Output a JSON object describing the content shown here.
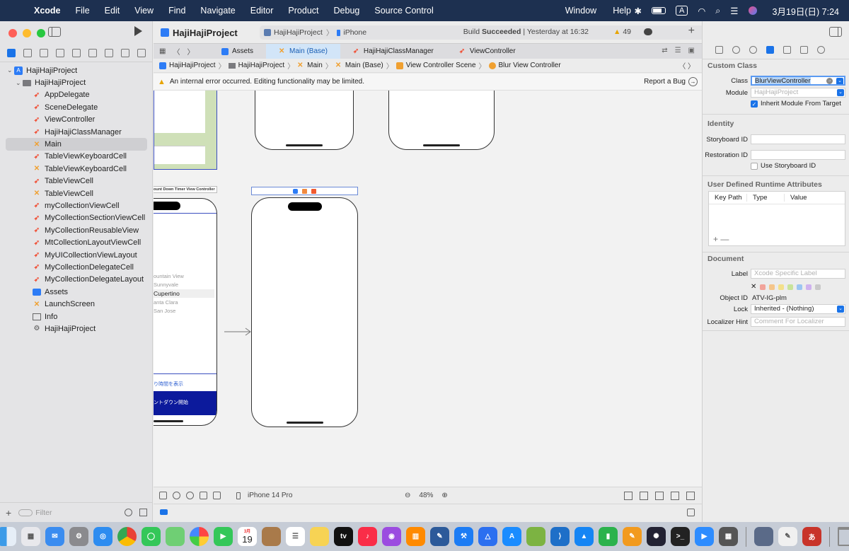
{
  "menubar": {
    "app": "Xcode",
    "items": [
      "File",
      "Edit",
      "View",
      "Find",
      "Navigate",
      "Editor",
      "Product",
      "Debug",
      "Source Control"
    ],
    "window": "Window",
    "help": "Help",
    "input_badge": "A",
    "clock": "3月19日(日)  7:24"
  },
  "navigator": {
    "filter_placeholder": "Filter",
    "root": "HajiHajiProject",
    "group": "HajiHajiProject",
    "files": [
      {
        "name": "AppDelegate",
        "type": "swift"
      },
      {
        "name": "SceneDelegate",
        "type": "swift"
      },
      {
        "name": "ViewController",
        "type": "swift"
      },
      {
        "name": "HajiHajiClassManager",
        "type": "swift"
      },
      {
        "name": "Main",
        "type": "storyboard",
        "selected": true
      },
      {
        "name": "TableViewKeyboardCell",
        "type": "swift"
      },
      {
        "name": "TableViewKeyboardCell",
        "type": "storyboard"
      },
      {
        "name": "TableViewCell",
        "type": "swift"
      },
      {
        "name": "TableViewCell",
        "type": "storyboard"
      },
      {
        "name": "myCollectionViewCell",
        "type": "swift"
      },
      {
        "name": "MyCollectionSectionViewCell",
        "type": "swift"
      },
      {
        "name": "MyCollectionReusableView",
        "type": "swift"
      },
      {
        "name": "MtCollectionLayoutViewCell",
        "type": "swift"
      },
      {
        "name": "MyUICollectionViewLayout",
        "type": "swift"
      },
      {
        "name": "MyCollectionDelegateCell",
        "type": "swift"
      },
      {
        "name": "MyCollectionDelegateLayout",
        "type": "swift"
      },
      {
        "name": "Assets",
        "type": "assets"
      },
      {
        "name": "LaunchScreen",
        "type": "storyboard"
      },
      {
        "name": "Info",
        "type": "plist"
      },
      {
        "name": "HajiHajiProject",
        "type": "gear"
      }
    ]
  },
  "toolbar": {
    "project_title": "HajiHajiProject",
    "scheme": "HajiHajiProject",
    "destination": "iPhone",
    "build_prefix": "Build",
    "build_status": "Succeeded",
    "build_time": "| Yesterday at 16:32",
    "warnings": "49"
  },
  "tabs": [
    {
      "label": "Assets",
      "active": false
    },
    {
      "label": "Main (Base)",
      "active": true
    },
    {
      "label": "HajiHajiClassManager",
      "active": false
    },
    {
      "label": "ViewController",
      "active": false
    }
  ],
  "jumpbar": [
    "HajiHajiProject",
    "HajiHajiProject",
    "Main",
    "Main (Base)",
    "View Controller Scene",
    "Blur View Controller"
  ],
  "error_bar": {
    "message": "An internal error occurred. Editing functionality may be limited.",
    "report": "Report a Bug"
  },
  "canvas": {
    "timer_scene_title": "ount Down Timer View Controller",
    "picker": [
      "ountain View",
      "Sunnyvale",
      "Cupertino",
      "anta Clara",
      "San Jose"
    ],
    "show_time_label": "り時間を表示",
    "start_button": "ントダウン開始",
    "device": "iPhone 14 Pro",
    "zoom": "48%"
  },
  "inspector": {
    "custom_class_header": "Custom Class",
    "class_label": "Class",
    "class_value": "BlurViewController",
    "module_label": "Module",
    "module_placeholder": "HajiHajiProject",
    "inherit_label": "Inherit Module From Target",
    "identity_header": "Identity",
    "storyboard_id_label": "Storyboard ID",
    "restoration_id_label": "Restoration ID",
    "use_storyboard_id": "Use Storyboard ID",
    "runtime_attrs_header": "User Defined Runtime Attributes",
    "col_key_path": "Key Path",
    "col_type": "Type",
    "col_value": "Value",
    "document_header": "Document",
    "label_label": "Label",
    "label_placeholder": "Xcode Specific Label",
    "object_id_label": "Object ID",
    "object_id_value": "ATV-IG-plm",
    "lock_label": "Lock",
    "lock_value": "Inherited - (Nothing)",
    "localizer_hint_label": "Localizer Hint",
    "localizer_hint_placeholder": "Comment For Localizer"
  },
  "dock": {
    "calendar_month": "3月",
    "calendar_day": "19"
  },
  "colors": {
    "accent": "#1a73e8",
    "swift": "#f05138",
    "storyboard": "#f0a030",
    "warning": "#e7a400",
    "menubar": "#1d3050"
  }
}
